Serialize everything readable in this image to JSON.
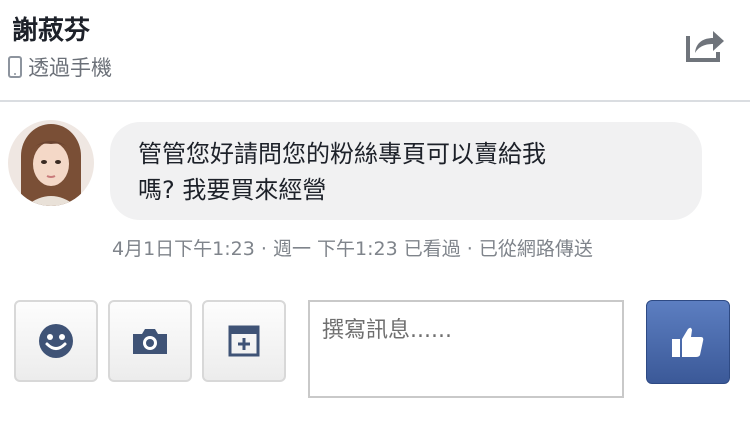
{
  "header": {
    "contact_name": "謝菽芬",
    "status_text": "透過手機"
  },
  "message": {
    "text_line1": "管管您好請問您的粉絲專頁可以賣給我",
    "text_line2": "嗎? 我要買來經營",
    "meta": "4月1日下午1:23 · 週一 下午1:23 已看過 · 已從網路傳送"
  },
  "composer": {
    "placeholder": "撰寫訊息......"
  },
  "colors": {
    "accent": "#3b5998",
    "bubble": "#f1f1f2",
    "icon": "#3f5376"
  }
}
